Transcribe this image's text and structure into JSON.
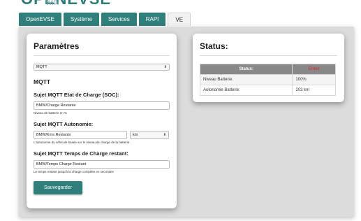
{
  "logo": {
    "main": "OPENEVSE",
    "sub": "WiFi"
  },
  "tabs": [
    {
      "label": "OpenEVSE"
    },
    {
      "label": "Système"
    },
    {
      "label": "Services"
    },
    {
      "label": "RAPI"
    },
    {
      "label": "VE"
    }
  ],
  "params": {
    "title": "Paramètres",
    "mode_select": "MQTT",
    "section_title": "MQTT",
    "soc_label": "Sujet MQTT Etat de Charge (SOC):",
    "soc_value": "BMW/Charge Restante",
    "soc_hint": "Niveau de batterie en %",
    "range_label": "Sujet MQTT Autonomie:",
    "range_value": "BMW/Kms Restants",
    "range_unit": "km",
    "range_hint": "L'autonomie du véhicule basée sur le niveau de charge de la batterie",
    "time_label": "Sujet MQTT Temps de Charge restant:",
    "time_value": "BMW/Temps Charge Restant",
    "time_hint": "Le temps restant jusqu'à la charge complète en secondes",
    "save_label": "Sauvegarder"
  },
  "status": {
    "title": "Status:",
    "header_label": "Status:",
    "header_value": "Erreur",
    "rows": [
      {
        "label": "Niveau Batterie:",
        "value": "100%"
      },
      {
        "label": "Autonomie Batterie:",
        "value": "203 km"
      }
    ]
  },
  "colors": {
    "accent": "#2f7f7a",
    "error": "#e02020",
    "panel_bg": "#dcdcdc"
  }
}
